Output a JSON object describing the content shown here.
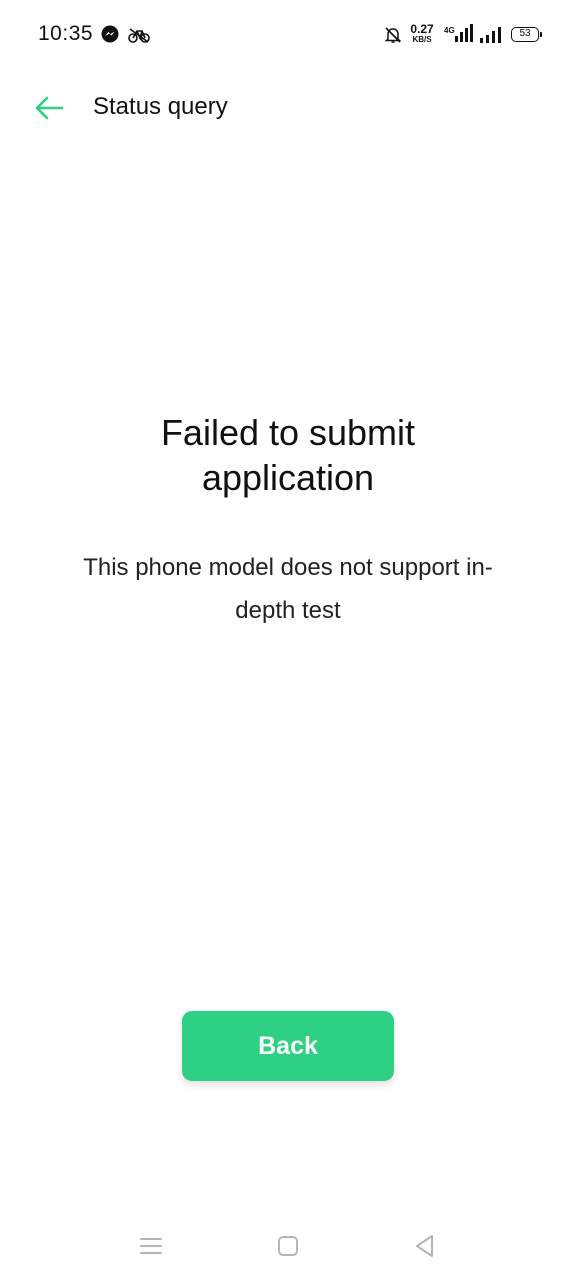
{
  "status_bar": {
    "time": "10:35",
    "net_speed_value": "0.27",
    "net_speed_unit": "KB/S",
    "network_type": "4G",
    "battery_level": "53",
    "icons": [
      "messenger-icon",
      "bike-icon",
      "mute-bell-icon",
      "signal-4g-icon",
      "signal-bars-icon",
      "battery-icon"
    ]
  },
  "header": {
    "title": "Status query",
    "back_icon": "arrow-left-icon"
  },
  "message": {
    "heading": "Failed to submit application",
    "body": "This phone model does not support in-depth test"
  },
  "actions": {
    "back_label": "Back"
  },
  "nav_bar": {
    "icons": [
      "menu-icon",
      "home-icon",
      "back-triangle-icon"
    ]
  },
  "colors": {
    "accent": "#2ed183",
    "text": "#111111",
    "background": "#ffffff"
  }
}
